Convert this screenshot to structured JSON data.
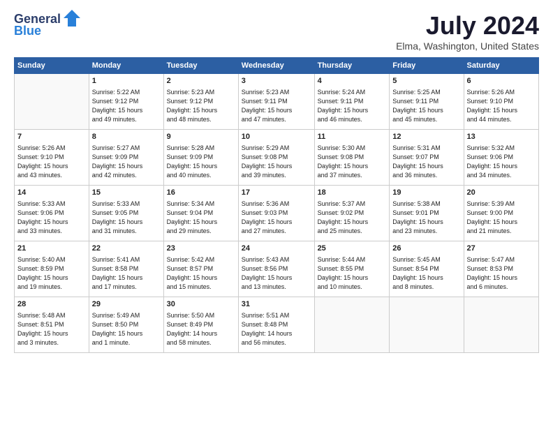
{
  "logo": {
    "line1": "General",
    "line2": "Blue"
  },
  "title": "July 2024",
  "location": "Elma, Washington, United States",
  "days_header": [
    "Sunday",
    "Monday",
    "Tuesday",
    "Wednesday",
    "Thursday",
    "Friday",
    "Saturday"
  ],
  "weeks": [
    [
      {
        "day": "",
        "info": ""
      },
      {
        "day": "1",
        "info": "Sunrise: 5:22 AM\nSunset: 9:12 PM\nDaylight: 15 hours\nand 49 minutes."
      },
      {
        "day": "2",
        "info": "Sunrise: 5:23 AM\nSunset: 9:12 PM\nDaylight: 15 hours\nand 48 minutes."
      },
      {
        "day": "3",
        "info": "Sunrise: 5:23 AM\nSunset: 9:11 PM\nDaylight: 15 hours\nand 47 minutes."
      },
      {
        "day": "4",
        "info": "Sunrise: 5:24 AM\nSunset: 9:11 PM\nDaylight: 15 hours\nand 46 minutes."
      },
      {
        "day": "5",
        "info": "Sunrise: 5:25 AM\nSunset: 9:11 PM\nDaylight: 15 hours\nand 45 minutes."
      },
      {
        "day": "6",
        "info": "Sunrise: 5:26 AM\nSunset: 9:10 PM\nDaylight: 15 hours\nand 44 minutes."
      }
    ],
    [
      {
        "day": "7",
        "info": "Sunrise: 5:26 AM\nSunset: 9:10 PM\nDaylight: 15 hours\nand 43 minutes."
      },
      {
        "day": "8",
        "info": "Sunrise: 5:27 AM\nSunset: 9:09 PM\nDaylight: 15 hours\nand 42 minutes."
      },
      {
        "day": "9",
        "info": "Sunrise: 5:28 AM\nSunset: 9:09 PM\nDaylight: 15 hours\nand 40 minutes."
      },
      {
        "day": "10",
        "info": "Sunrise: 5:29 AM\nSunset: 9:08 PM\nDaylight: 15 hours\nand 39 minutes."
      },
      {
        "day": "11",
        "info": "Sunrise: 5:30 AM\nSunset: 9:08 PM\nDaylight: 15 hours\nand 37 minutes."
      },
      {
        "day": "12",
        "info": "Sunrise: 5:31 AM\nSunset: 9:07 PM\nDaylight: 15 hours\nand 36 minutes."
      },
      {
        "day": "13",
        "info": "Sunrise: 5:32 AM\nSunset: 9:06 PM\nDaylight: 15 hours\nand 34 minutes."
      }
    ],
    [
      {
        "day": "14",
        "info": "Sunrise: 5:33 AM\nSunset: 9:06 PM\nDaylight: 15 hours\nand 33 minutes."
      },
      {
        "day": "15",
        "info": "Sunrise: 5:33 AM\nSunset: 9:05 PM\nDaylight: 15 hours\nand 31 minutes."
      },
      {
        "day": "16",
        "info": "Sunrise: 5:34 AM\nSunset: 9:04 PM\nDaylight: 15 hours\nand 29 minutes."
      },
      {
        "day": "17",
        "info": "Sunrise: 5:36 AM\nSunset: 9:03 PM\nDaylight: 15 hours\nand 27 minutes."
      },
      {
        "day": "18",
        "info": "Sunrise: 5:37 AM\nSunset: 9:02 PM\nDaylight: 15 hours\nand 25 minutes."
      },
      {
        "day": "19",
        "info": "Sunrise: 5:38 AM\nSunset: 9:01 PM\nDaylight: 15 hours\nand 23 minutes."
      },
      {
        "day": "20",
        "info": "Sunrise: 5:39 AM\nSunset: 9:00 PM\nDaylight: 15 hours\nand 21 minutes."
      }
    ],
    [
      {
        "day": "21",
        "info": "Sunrise: 5:40 AM\nSunset: 8:59 PM\nDaylight: 15 hours\nand 19 minutes."
      },
      {
        "day": "22",
        "info": "Sunrise: 5:41 AM\nSunset: 8:58 PM\nDaylight: 15 hours\nand 17 minutes."
      },
      {
        "day": "23",
        "info": "Sunrise: 5:42 AM\nSunset: 8:57 PM\nDaylight: 15 hours\nand 15 minutes."
      },
      {
        "day": "24",
        "info": "Sunrise: 5:43 AM\nSunset: 8:56 PM\nDaylight: 15 hours\nand 13 minutes."
      },
      {
        "day": "25",
        "info": "Sunrise: 5:44 AM\nSunset: 8:55 PM\nDaylight: 15 hours\nand 10 minutes."
      },
      {
        "day": "26",
        "info": "Sunrise: 5:45 AM\nSunset: 8:54 PM\nDaylight: 15 hours\nand 8 minutes."
      },
      {
        "day": "27",
        "info": "Sunrise: 5:47 AM\nSunset: 8:53 PM\nDaylight: 15 hours\nand 6 minutes."
      }
    ],
    [
      {
        "day": "28",
        "info": "Sunrise: 5:48 AM\nSunset: 8:51 PM\nDaylight: 15 hours\nand 3 minutes."
      },
      {
        "day": "29",
        "info": "Sunrise: 5:49 AM\nSunset: 8:50 PM\nDaylight: 15 hours\nand 1 minute."
      },
      {
        "day": "30",
        "info": "Sunrise: 5:50 AM\nSunset: 8:49 PM\nDaylight: 14 hours\nand 58 minutes."
      },
      {
        "day": "31",
        "info": "Sunrise: 5:51 AM\nSunset: 8:48 PM\nDaylight: 14 hours\nand 56 minutes."
      },
      {
        "day": "",
        "info": ""
      },
      {
        "day": "",
        "info": ""
      },
      {
        "day": "",
        "info": ""
      }
    ]
  ]
}
